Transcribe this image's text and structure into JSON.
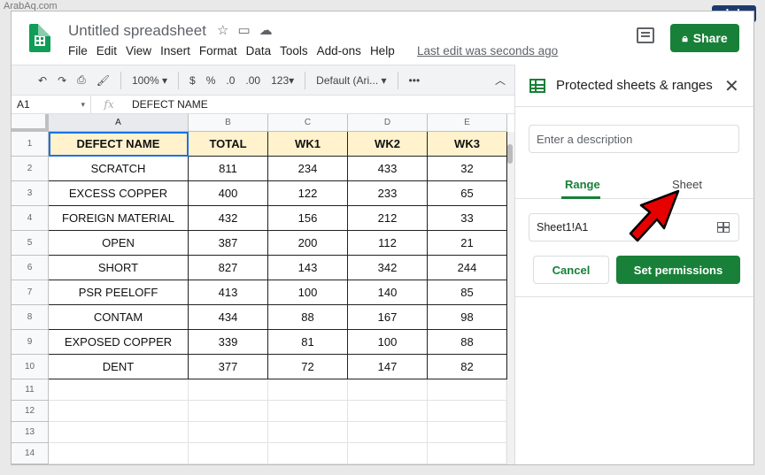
{
  "watermark": "ArabAq.com",
  "brand_badge": "alphr",
  "app": {
    "doc_title": "Untitled spreadsheet",
    "last_edit": "Last edit was seconds ago",
    "share_label": "Share",
    "menu": [
      "File",
      "Edit",
      "View",
      "Insert",
      "Format",
      "Data",
      "Tools",
      "Add-ons",
      "Help"
    ]
  },
  "toolbar": {
    "zoom": "100%",
    "currency": "$",
    "percent": "%",
    "dec_decrease": ".0",
    "dec_increase": ".00",
    "number_format": "123",
    "font": "Default (Ari...",
    "more": "•••"
  },
  "formula_bar": {
    "cell_ref": "A1",
    "fx": "fx",
    "content": "DEFECT NAME"
  },
  "sheet": {
    "columns": [
      "A",
      "B",
      "C",
      "D",
      "E"
    ],
    "row_numbers": [
      "1",
      "2",
      "3",
      "4",
      "5",
      "6",
      "7",
      "8",
      "9",
      "10",
      "11",
      "12",
      "13",
      "14"
    ],
    "header": [
      "DEFECT NAME",
      "TOTAL",
      "WK1",
      "WK2",
      "WK3"
    ],
    "rows": [
      [
        "SCRATCH",
        "811",
        "234",
        "433",
        "32"
      ],
      [
        "EXCESS COPPER",
        "400",
        "122",
        "233",
        "65"
      ],
      [
        "FOREIGN MATERIAL",
        "432",
        "156",
        "212",
        "33"
      ],
      [
        "OPEN",
        "387",
        "200",
        "112",
        "21"
      ],
      [
        "SHORT",
        "827",
        "143",
        "342",
        "244"
      ],
      [
        "PSR PEELOFF",
        "413",
        "100",
        "140",
        "85"
      ],
      [
        "CONTAM",
        "434",
        "88",
        "167",
        "98"
      ],
      [
        "EXPOSED COPPER",
        "339",
        "81",
        "100",
        "88"
      ],
      [
        "DENT",
        "377",
        "72",
        "147",
        "82"
      ]
    ]
  },
  "panel": {
    "title": "Protected sheets & ranges",
    "description_placeholder": "Enter a description",
    "tab_range": "Range",
    "tab_sheet": "Sheet",
    "range_value": "Sheet1!A1",
    "cancel_label": "Cancel",
    "set_permissions_label": "Set permissions"
  },
  "colors": {
    "accent_green": "#188038",
    "header_fill": "#fff2cc",
    "arrow_red": "#e60000"
  }
}
